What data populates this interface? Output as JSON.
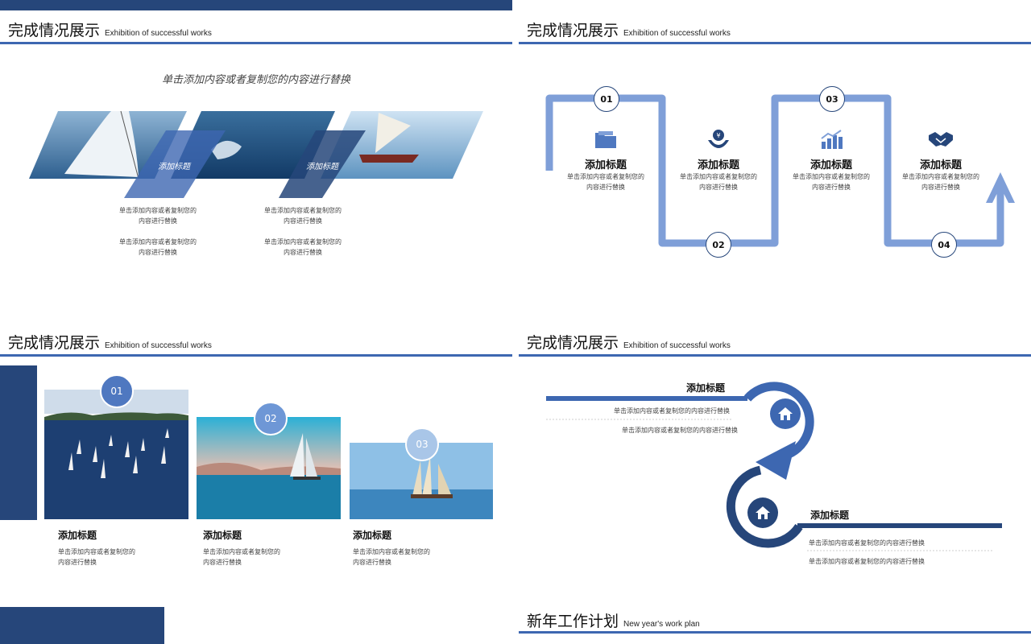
{
  "colors": {
    "navy": "#26467a",
    "blue": "#3d67b1",
    "light_blue": "#7f9fd8",
    "pale": "#a9c6e8"
  },
  "slide1": {
    "title_zh": "完成情况展示",
    "title_en": "Exhibition of successful works",
    "subtitle": "单击添加内容或者复制您的内容进行替换",
    "overlay_a": "添加标题",
    "overlay_b": "添加标题",
    "col1_line1": "单击添加内容或者复制您的",
    "col1_line2": "内容进行替换",
    "col1_line3": "单击添加内容或者复制您的",
    "col1_line4": "内容进行替换",
    "col2_line1": "单击添加内容或者复制您的",
    "col2_line2": "内容进行替换",
    "col2_line3": "单击添加内容或者复制您的",
    "col2_line4": "内容进行替换"
  },
  "slide2": {
    "title_zh": "完成情况展示",
    "title_en": "Exhibition of successful works",
    "steps": [
      {
        "num": "01",
        "title": "添加标题",
        "line1": "单击添加内容或者复制您的",
        "line2": "内容进行替换",
        "icon": "folder-icon"
      },
      {
        "num": "02",
        "title": "添加标题",
        "line1": "单击添加内容或者复制您的",
        "line2": "内容进行替换",
        "icon": "money-hand-icon"
      },
      {
        "num": "03",
        "title": "添加标题",
        "line1": "单击添加内容或者复制您的",
        "line2": "内容进行替换",
        "icon": "bar-chart-icon"
      },
      {
        "num": "04",
        "title": "添加标题",
        "line1": "单击添加内容或者复制您的",
        "line2": "内容进行替换",
        "icon": "handshake-icon"
      }
    ]
  },
  "slide3": {
    "title_zh": "完成情况展示",
    "title_en": "Exhibition of successful works",
    "cards": [
      {
        "num": "01",
        "title": "添加标题",
        "line1": "单击添加内容或者复制您的",
        "line2": "内容进行替换"
      },
      {
        "num": "02",
        "title": "添加标题",
        "line1": "单击添加内容或者复制您的",
        "line2": "内容进行替换"
      },
      {
        "num": "03",
        "title": "添加标题",
        "line1": "单击添加内容或者复制您的",
        "line2": "内容进行替换"
      }
    ]
  },
  "slide4": {
    "title_zh": "完成情况展示",
    "title_en": "Exhibition of successful works",
    "top": {
      "title": "添加标题",
      "line1": "单击添加内容或者复制您的内容进行替换",
      "line2": "单击添加内容或者复制您的内容进行替换"
    },
    "bottom": {
      "title": "添加标题",
      "line1": "单击添加内容或者复制您的内容进行替换",
      "line2": "单击添加内容或者复制您的内容进行替换"
    }
  },
  "slide5": {
    "title_zh": "新年工作计划",
    "title_en": "New year's work plan"
  }
}
